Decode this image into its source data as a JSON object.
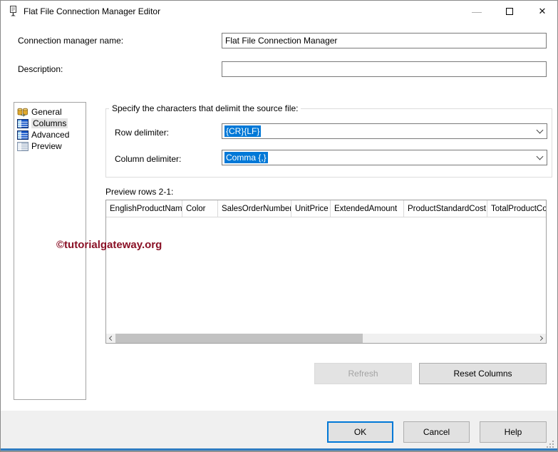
{
  "window": {
    "title": "Flat File Connection Manager Editor",
    "controls": {
      "minimize": "—",
      "close": "✕"
    }
  },
  "form": {
    "name_label": "Connection manager name:",
    "name_value": "Flat File Connection Manager",
    "description_label": "Description:",
    "description_value": ""
  },
  "sidebar": {
    "items": [
      {
        "label": "General"
      },
      {
        "label": "Columns"
      },
      {
        "label": "Advanced"
      },
      {
        "label": "Preview"
      }
    ],
    "selected": "Columns"
  },
  "delimiters": {
    "group_label": "Specify the characters that delimit the source file:",
    "row_label": "Row delimiter:",
    "row_value": "{CR}{LF}",
    "column_label": "Column delimiter:",
    "column_value": "Comma {,}"
  },
  "preview": {
    "label": "Preview rows 2-1:",
    "columns": [
      "EnglishProductName",
      "Color",
      "SalesOrderNumber",
      "UnitPrice",
      "ExtendedAmount",
      "ProductStandardCost",
      "TotalProductCost"
    ],
    "rows": []
  },
  "watermark": "©tutorialgateway.org",
  "buttons": {
    "refresh": "Refresh",
    "reset_columns": "Reset Columns",
    "ok": "OK",
    "cancel": "Cancel",
    "help": "Help"
  },
  "colors": {
    "selection_blue": "#0078d7",
    "focus_border": "#0078d7",
    "watermark_red": "#8a1126",
    "bottom_bar_blue": "#2e7cc1"
  }
}
